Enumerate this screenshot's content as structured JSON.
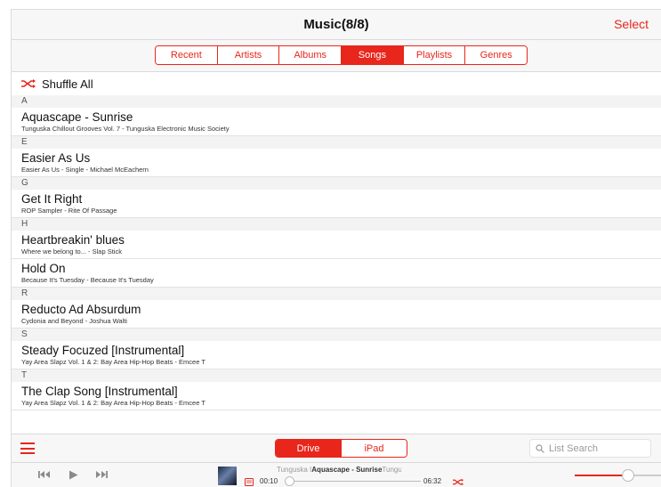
{
  "header": {
    "title": "Music(8/8)",
    "select_label": "Select"
  },
  "categories": [
    {
      "label": "Recent",
      "active": false
    },
    {
      "label": "Artists",
      "active": false
    },
    {
      "label": "Albums",
      "active": false
    },
    {
      "label": "Songs",
      "active": true
    },
    {
      "label": "Playlists",
      "active": false
    },
    {
      "label": "Genres",
      "active": false
    }
  ],
  "shuffle": {
    "label": "Shuffle All",
    "icon": "shuffle-icon"
  },
  "sections": [
    {
      "letter": "A",
      "songs": [
        {
          "title": "Aquascape - Sunrise",
          "subtitle": "Tunguska Chillout Grooves Vol. 7 - Tunguska Electronic Music Society"
        }
      ]
    },
    {
      "letter": "E",
      "songs": [
        {
          "title": "Easier As Us",
          "subtitle": "Easier As Us - Single - Michael McEachern"
        }
      ]
    },
    {
      "letter": "G",
      "songs": [
        {
          "title": "Get It Right",
          "subtitle": "ROP Sampler - Rite Of Passage"
        }
      ]
    },
    {
      "letter": "H",
      "songs": [
        {
          "title": "Heartbreakin' blues",
          "subtitle": "Where we belong to... - Slap Stick"
        },
        {
          "title": "Hold On",
          "subtitle": "Because It's Tuesday - Because It's Tuesday"
        }
      ]
    },
    {
      "letter": "R",
      "songs": [
        {
          "title": "Reducto Ad Absurdum",
          "subtitle": "Cydonia and Beyond - Joshua Walti"
        }
      ]
    },
    {
      "letter": "S",
      "songs": [
        {
          "title": "Steady Focuzed [Instrumental]",
          "subtitle": "Yay Area Slapz Vol. 1 & 2: Bay Area Hip-Hop Beats - Emcee T"
        }
      ]
    },
    {
      "letter": "T",
      "songs": [
        {
          "title": "The Clap Song [Instrumental]",
          "subtitle": "Yay Area Slapz Vol. 1 & 2: Bay Area Hip-Hop Beats - Emcee T"
        }
      ]
    }
  ],
  "bottom": {
    "devices": [
      {
        "label": "Drive",
        "active": true
      },
      {
        "label": "iPad",
        "active": false
      }
    ],
    "search_placeholder": "List Search"
  },
  "player": {
    "now_playing_prefix": "Tunguska I",
    "now_playing_title": "Aquascape - Sunrise",
    "now_playing_suffix": "Tunguska I",
    "elapsed": "00:10",
    "duration": "06:32",
    "progress_fraction": 0.026,
    "volume_fraction": 0.6
  },
  "colors": {
    "accent": "#e8261c",
    "bar_bg": "#f7f7f7",
    "section_bg": "#f3f3f3"
  }
}
